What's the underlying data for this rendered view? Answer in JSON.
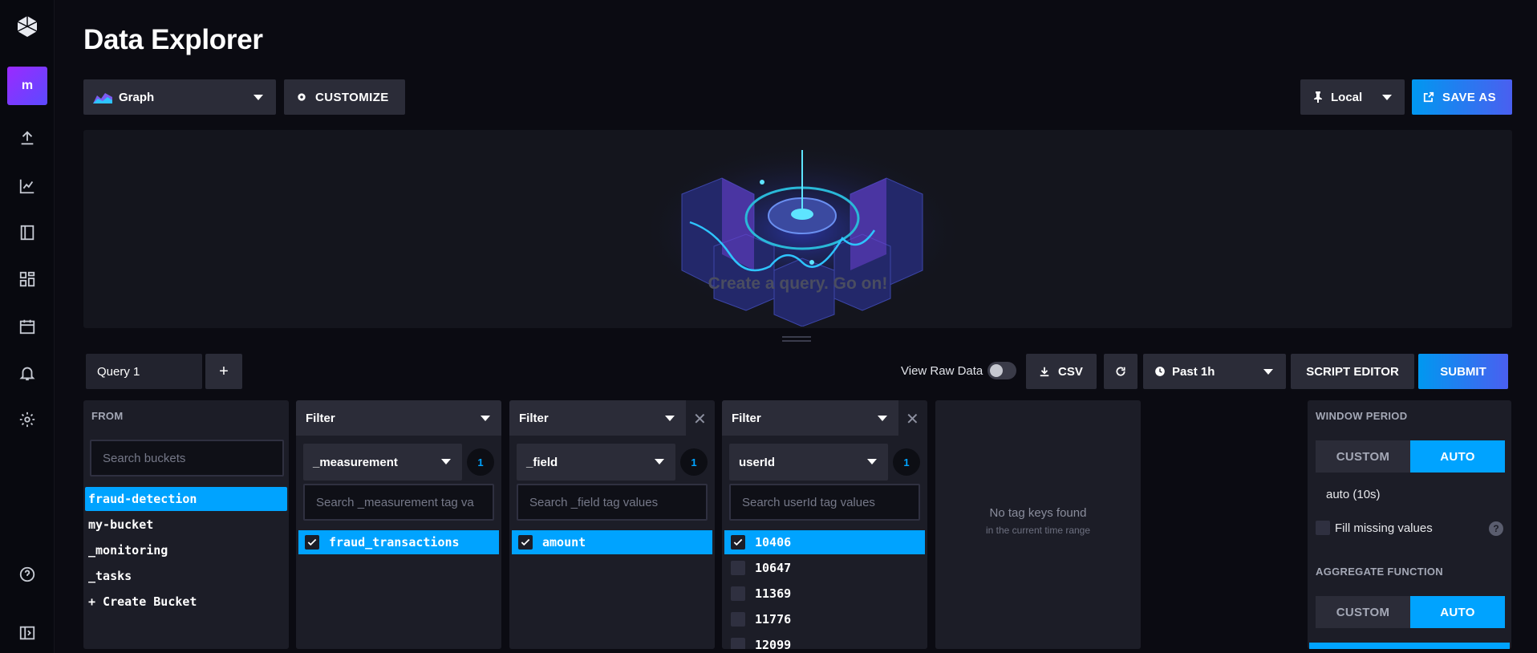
{
  "page_title": "Data Explorer",
  "toolbar": {
    "graph_type": "Graph",
    "customize_label": "CUSTOMIZE",
    "timezone": "Local",
    "save_as_label": "SAVE AS"
  },
  "graph": {
    "empty_message": "Create a query. Go on!"
  },
  "query_bar": {
    "tabs": [
      "Query 1"
    ],
    "add_label": "+",
    "view_raw_label": "View Raw Data",
    "view_raw_enabled": false,
    "csv_label": "CSV",
    "time_range": "Past 1h",
    "script_editor_label": "SCRIPT EDITOR",
    "submit_label": "SUBMIT"
  },
  "from": {
    "label": "FROM",
    "search_placeholder": "Search buckets",
    "buckets": [
      "fraud-detection",
      "my-bucket",
      "_monitoring",
      "_tasks",
      "+ Create Bucket"
    ],
    "selected": "fraud-detection"
  },
  "filters": [
    {
      "head": "Filter",
      "key": "_measurement",
      "count": "1",
      "search_placeholder": "Search _measurement tag va",
      "values": [
        {
          "label": "fraud_transactions",
          "checked": true
        }
      ]
    },
    {
      "head": "Filter",
      "key": "_field",
      "count": "1",
      "search_placeholder": "Search _field tag values",
      "values": [
        {
          "label": "amount",
          "checked": true
        }
      ]
    },
    {
      "head": "Filter",
      "key": "userId",
      "count": "1",
      "search_placeholder": "Search userId tag values",
      "values": [
        {
          "label": "10406",
          "checked": true
        },
        {
          "label": "10647",
          "checked": false
        },
        {
          "label": "11369",
          "checked": false
        },
        {
          "label": "11776",
          "checked": false
        },
        {
          "label": "12099",
          "checked": false
        }
      ]
    }
  ],
  "empty_filter": {
    "title": "No tag keys found",
    "subtitle": "in the current time range"
  },
  "window": {
    "period_label": "WINDOW PERIOD",
    "custom_label": "CUSTOM",
    "auto_label": "AUTO",
    "auto_value": "auto (10s)",
    "fill_missing_label": "Fill missing values",
    "aggregate_label": "AGGREGATE FUNCTION",
    "agg_custom_label": "CUSTOM",
    "agg_auto_label": "AUTO"
  },
  "colors": {
    "accent": "#00a3ff",
    "brand_gradient_start": "#0098f0",
    "brand_gradient_end": "#4a5ff0",
    "background": "#0b0b12",
    "panel": "#1c1d27"
  },
  "icons": [
    "cube-logo-icon",
    "upload-icon",
    "chart-icon",
    "notebook-icon",
    "dashboard-icon",
    "calendar-icon",
    "bell-icon",
    "gear-icon",
    "help-icon",
    "collapse-icon"
  ]
}
